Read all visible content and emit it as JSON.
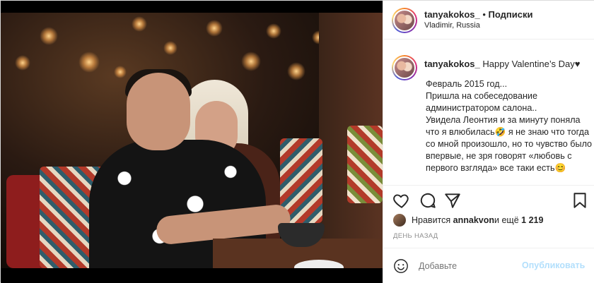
{
  "header": {
    "username": "tanyakokos_",
    "follow_separator": " • ",
    "follow_label": "Подписки",
    "location": "Vladimir, Russia"
  },
  "caption": {
    "username": "tanyakokos_",
    "headline": "Happy Valentine’s Day♥",
    "body": "Февраль 2015 год...\nПришла на собеседование администратором салона..\nУвидела Леонтия и за минуту поняла что я влюбилась🤣 я не знаю что тогда со мной произошло, но то чувство было впервые, не зря говорят «любовь с первого взгляда» все таки есть😊"
  },
  "actions": {
    "like_icon": "heart-icon",
    "comment_icon": "comment-icon",
    "share_icon": "share-icon",
    "save_icon": "bookmark-icon"
  },
  "likes": {
    "prefix": "Нравится ",
    "user": "annakvon",
    "middle": " и ещё ",
    "count": "1 219"
  },
  "time_ago": "ДЕНЬ НАЗАД",
  "comment": {
    "placeholder": "Добавьте",
    "publish_label": "Опубликовать"
  },
  "colors": {
    "text": "#262626",
    "muted": "#8e8e8e",
    "publish_disabled": "#b2dffc"
  }
}
